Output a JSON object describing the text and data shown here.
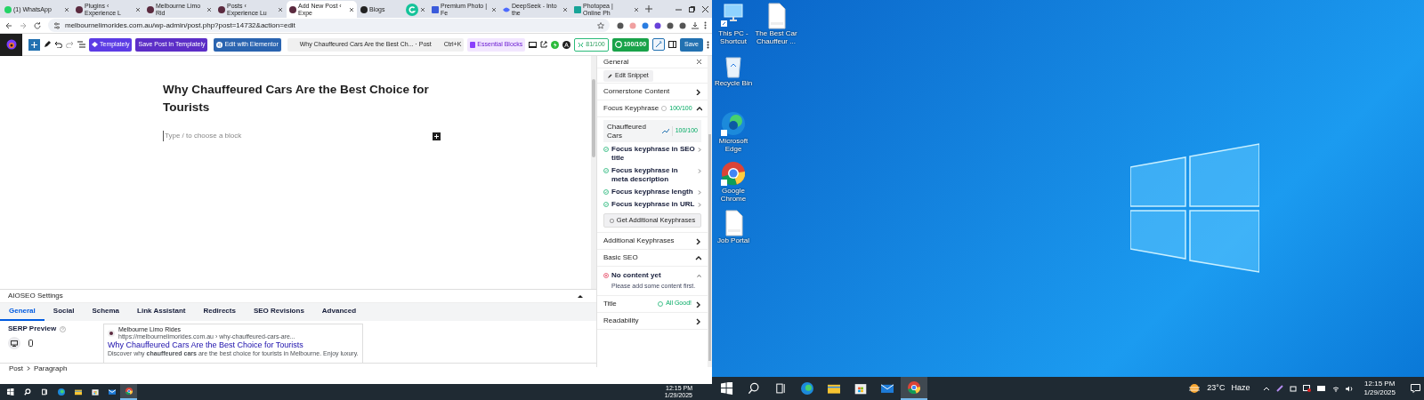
{
  "browser": {
    "tabs": [
      {
        "label": "(1) WhatsApp",
        "kind": "whatsapp",
        "selected": false
      },
      {
        "label": "Plugins ‹ Experience L",
        "kind": "site",
        "selected": false
      },
      {
        "label": "Melbourne Limo Rid",
        "kind": "site",
        "selected": false
      },
      {
        "label": "Posts ‹ Experience Lu",
        "kind": "site",
        "selected": false
      },
      {
        "label": "Add New Post ‹ Expe",
        "kind": "site",
        "selected": true
      },
      {
        "label": "Blogs",
        "kind": "blog",
        "selected": false
      },
      {
        "label": "Premium Photo | Fe",
        "kind": "photo",
        "selected": false
      },
      {
        "label": "DeepSeek - Into the",
        "kind": "deepseek",
        "selected": false
      },
      {
        "label": "Photopea | Online Ph",
        "kind": "photopea",
        "selected": false
      }
    ],
    "url": "melbournelimorides.com.au/wp-admin/post.php?post=14732&action=edit"
  },
  "editor_toolbar": {
    "templately": "Templately",
    "save_templately": "Save Post In Templately",
    "elementor": "Edit with Elementor",
    "command_title": "Why Chauffeured Cars Are the Best Ch... · Post",
    "command_shortcut": "Ctrl+K",
    "essential_blocks": "Essential Blocks",
    "seo_score": "81/100",
    "truseo_score": "100/100",
    "save": "Save"
  },
  "post": {
    "title": "Why Chauffeured Cars Are the Best Choice for Tourists",
    "placeholder": "Type / to choose a block"
  },
  "sidebar": {
    "title": "General",
    "edit_snippet": "Edit Snippet",
    "items": [
      {
        "kind": "section",
        "label": "Cornerstone Content",
        "expanded": false
      },
      {
        "kind": "section",
        "label": "Focus Keyphrase",
        "expanded": true,
        "score": "100/100"
      },
      {
        "kind": "keyphrase",
        "text": "Chauffeured Cars",
        "score": "100/100"
      },
      {
        "kind": "check",
        "label": "Focus keyphrase in SEO title",
        "passed": true
      },
      {
        "kind": "check",
        "label": "Focus keyphrase in meta description",
        "passed": true
      },
      {
        "kind": "check",
        "label": "Focus keyphrase length",
        "passed": true
      },
      {
        "kind": "check",
        "label": "Focus keyphrase in URL",
        "passed": true
      },
      {
        "kind": "button",
        "label": "Get Additional Keyphrases"
      },
      {
        "kind": "section",
        "label": "Additional Keyphrases",
        "expanded": false
      },
      {
        "kind": "section",
        "label": "Basic SEO",
        "expanded": true
      },
      {
        "kind": "problem",
        "label": "No content yet",
        "description": "Please add some content first.",
        "expanded": true
      },
      {
        "kind": "section",
        "label": "Title",
        "expanded": false,
        "badge": "All Good!"
      },
      {
        "kind": "section",
        "label": "Readability",
        "expanded": false
      }
    ]
  },
  "aioseo": {
    "title": "AIOSEO Settings",
    "expanded": true,
    "tabs": [
      {
        "label": "General",
        "selected": true
      },
      {
        "label": "Social",
        "selected": false
      },
      {
        "label": "Schema",
        "selected": false
      },
      {
        "label": "Link Assistant",
        "selected": false
      },
      {
        "label": "Redirects",
        "selected": false
      },
      {
        "label": "SEO Revisions",
        "selected": false
      },
      {
        "label": "Advanced",
        "selected": false
      }
    ],
    "serp_label": "SERP Preview",
    "devices": [
      {
        "kind": "desktop",
        "selected": true
      },
      {
        "kind": "mobile",
        "selected": false
      }
    ],
    "preview": {
      "site": "Melbourne Limo Rides",
      "url": "https://melbournelimorides.com.au › why-chauffeured-cars-are...",
      "title": "Why Chauffeured Cars Are the Best Choice for Tourists",
      "description": "Discover why **chauffeured cars** are the best choice for tourists in Melbourne. Enjoy luxury."
    }
  },
  "breadcrumb": [
    "Post",
    "Paragraph"
  ],
  "left_taskbar": {
    "apps": [
      {
        "kind": "start",
        "active": false
      },
      {
        "kind": "search",
        "active": false
      },
      {
        "kind": "taskview",
        "active": false
      },
      {
        "kind": "edge",
        "active": false
      },
      {
        "kind": "explorer",
        "active": false
      },
      {
        "kind": "store",
        "active": false
      },
      {
        "kind": "mail",
        "active": false
      },
      {
        "kind": "chrome",
        "active": true
      }
    ],
    "time": "12:15 PM",
    "date": "1/29/2025"
  },
  "desktop": {
    "columns": [
      [
        {
          "kind": "pc",
          "label": "This PC - Shortcut"
        },
        {
          "kind": "recycle",
          "label": "Recycle Bin"
        },
        {
          "kind": "edge",
          "label": "Microsoft Edge"
        },
        {
          "kind": "chrome",
          "label": "Google Chrome"
        },
        {
          "kind": "docx",
          "label": "Job Portal"
        }
      ],
      [
        {
          "kind": "docx",
          "label": "The Best Car Chauffeur ..."
        }
      ]
    ]
  },
  "taskbar": {
    "apps": [
      {
        "kind": "start",
        "active": false
      },
      {
        "kind": "search",
        "active": false
      },
      {
        "kind": "taskview",
        "active": false
      },
      {
        "kind": "edge",
        "active": false
      },
      {
        "kind": "explorer",
        "active": false
      },
      {
        "kind": "store",
        "active": false
      },
      {
        "kind": "mail",
        "active": false
      },
      {
        "kind": "chrome",
        "active": true
      }
    ],
    "temperature": "23°C",
    "weather": "Haze",
    "time": "12:15 PM",
    "date": "1/29/2025"
  }
}
